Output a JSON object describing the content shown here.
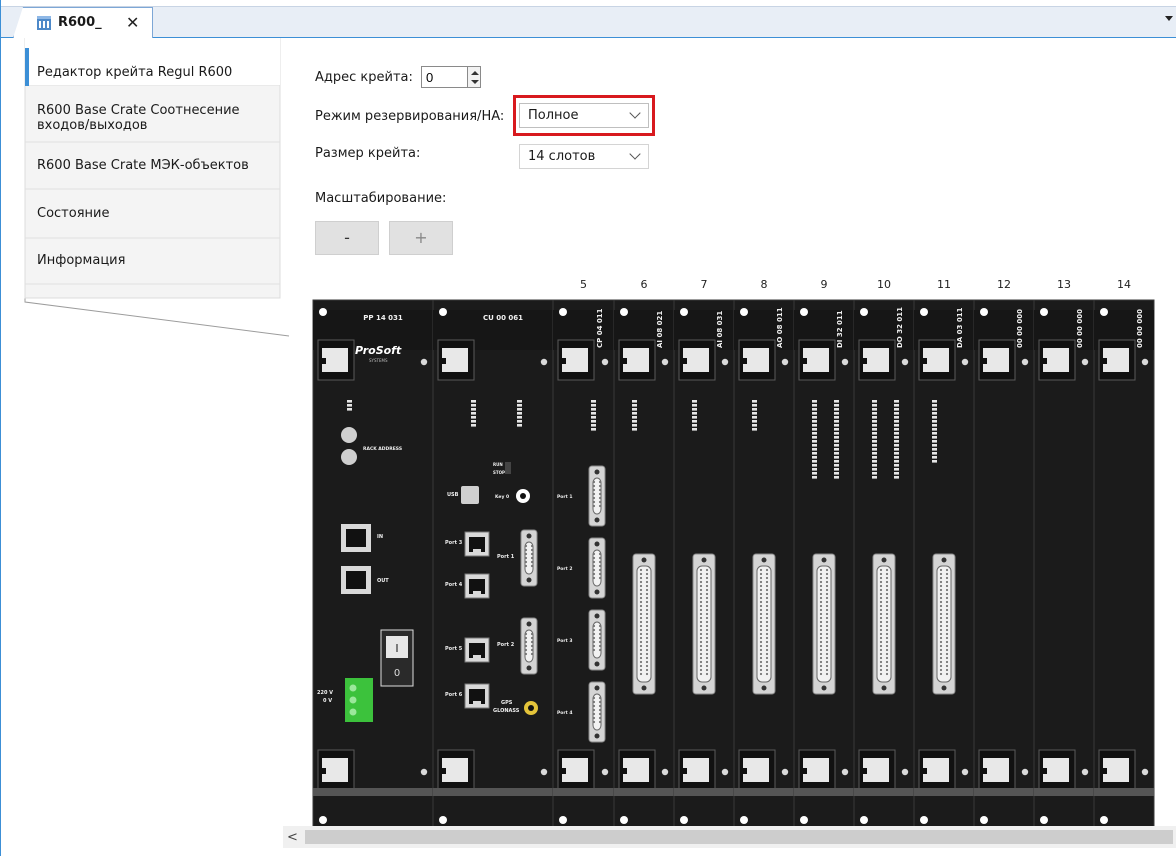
{
  "tab": {
    "title": "R600_",
    "close": "✕"
  },
  "sidebar": {
    "items": [
      {
        "label": "Редактор крейта Regul R600"
      },
      {
        "label": "R600 Base Crate Соотнесение входов/выходов"
      },
      {
        "label": "R600 Base Crate МЭК-объектов"
      },
      {
        "label": "Состояние"
      },
      {
        "label": "Информация"
      }
    ]
  },
  "form": {
    "address_label": "Адрес крейта:",
    "address_value": "0",
    "redundancy_label": "Режим резервирования/HA:",
    "redundancy_value": "Полное",
    "size_label": "Размер крейта:",
    "size_value": "14 слотов",
    "zoom_label": "Масштабирование:",
    "zoom_minus": "-",
    "zoom_plus": "+"
  },
  "crate": {
    "slot_numbers": [
      "5",
      "6",
      "7",
      "8",
      "9",
      "10",
      "11",
      "12",
      "13",
      "14"
    ],
    "modules": [
      {
        "name": "PP 14 031"
      },
      {
        "name": "CU 00 061"
      },
      {
        "name": "CP 04 011"
      },
      {
        "name": "AI 08 021"
      },
      {
        "name": "AI 08 031"
      },
      {
        "name": "AO 08 011"
      },
      {
        "name": "DI 32 011"
      },
      {
        "name": "DO 32 011"
      },
      {
        "name": "DA 03 011"
      },
      {
        "name": "00 00 000"
      },
      {
        "name": "00 00 000"
      },
      {
        "name": "00 00 000"
      }
    ],
    "brand": "ProSoft",
    "brand_sub": "SYSTEMS",
    "pp_labels": {
      "rack": "RACK ADDRESS",
      "in": "IN",
      "out": "OUT",
      "v220": "220 V",
      "v0": "0 V",
      "sw_on": "I",
      "sw_off": "0"
    },
    "cu_labels": {
      "usb": "USB",
      "key": "Key 0",
      "port1": "Port 1",
      "port2": "Port 2",
      "port3": "Port 3",
      "port4": "Port 4",
      "port5": "Port 5",
      "port6": "Port 6",
      "gps": "GPS",
      "glonass": "GLONASS",
      "run": "RUN",
      "stop": "STOP"
    },
    "cp_ports": [
      "Port 1",
      "Port 2",
      "Port 3",
      "Port 4"
    ]
  },
  "colors": {
    "accent": "#3c8fd6",
    "highlight": "#d8191e",
    "module": "#1b1b1b"
  }
}
